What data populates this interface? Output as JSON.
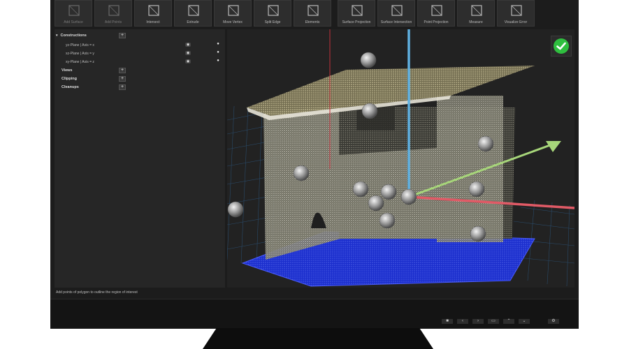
{
  "toolbar": {
    "tools": [
      {
        "label": "Add Surface",
        "dim": true
      },
      {
        "label": "Add Points",
        "dim": true
      },
      {
        "label": "Intersect",
        "dim": false
      },
      {
        "label": "Extrude",
        "dim": false
      },
      {
        "label": "Move Vertex",
        "dim": false
      },
      {
        "label": "Split Edge",
        "dim": false
      },
      {
        "label": "Elements",
        "dim": false
      },
      {
        "label": "Surface Projection",
        "dim": false
      },
      {
        "label": "Surface Intersection",
        "dim": false
      },
      {
        "label": "Point Projection",
        "dim": false
      },
      {
        "label": "Measure",
        "dim": false
      },
      {
        "label": "Visualize Error",
        "dim": false
      }
    ]
  },
  "panel": {
    "constructions": {
      "label": "Constructions",
      "items": [
        {
          "label": "yz-Plane | Axis = x"
        },
        {
          "label": "xz-Plane | Axis = y"
        },
        {
          "label": "xy-Plane | Axis = z"
        }
      ]
    },
    "views": "Views",
    "clipping": "Clipping",
    "cleanups": "Cleanups",
    "plus_glyph": "+"
  },
  "status": "Add points of polygon to outline the region of interest",
  "colors": {
    "x_axis": "#e05a66",
    "y_axis": "#a7d67a",
    "z_axis": "#5fb0e0",
    "floor_grid": "#2a4a68",
    "accept": "#2fbf3f"
  },
  "icons": {
    "eye": "eye-icon",
    "drop": "droplet-icon",
    "check": "checkmark-icon"
  }
}
